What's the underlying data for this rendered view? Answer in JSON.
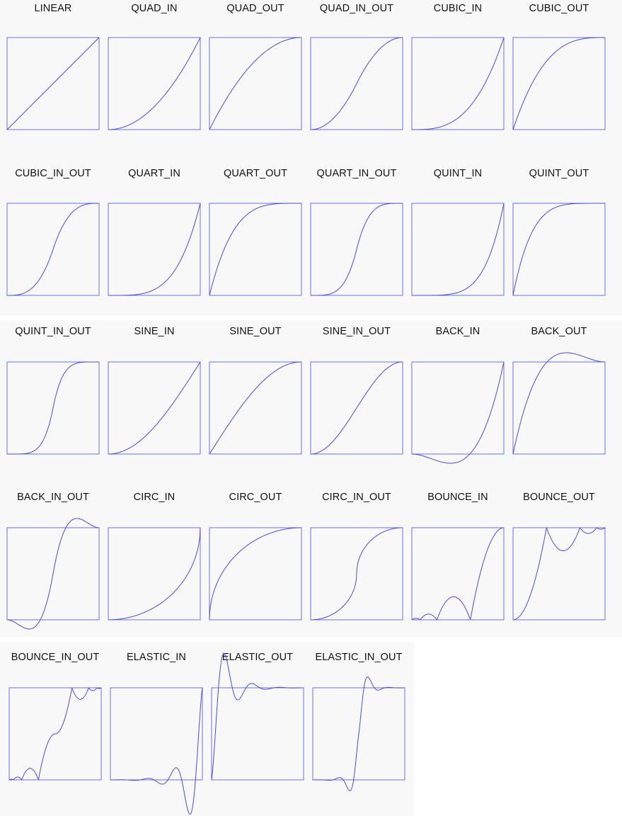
{
  "curve_color": "#4a4ae8",
  "box_color": "#6b6bf0",
  "panels": [
    {
      "name": "panel-1",
      "cells": [
        {
          "label": "LINEAR",
          "fn": "LINEAR"
        },
        {
          "label": "QUAD_IN",
          "fn": "QUAD_IN"
        },
        {
          "label": "QUAD_OUT",
          "fn": "QUAD_OUT"
        },
        {
          "label": "QUAD_IN_OUT",
          "fn": "QUAD_IN_OUT"
        },
        {
          "label": "CUBIC_IN",
          "fn": "CUBIC_IN"
        },
        {
          "label": "CUBIC_OUT",
          "fn": "CUBIC_OUT"
        },
        {
          "label": "CUBIC_IN_OUT",
          "fn": "CUBIC_IN_OUT"
        },
        {
          "label": "QUART_IN",
          "fn": "QUART_IN"
        },
        {
          "label": "QUART_OUT",
          "fn": "QUART_OUT"
        },
        {
          "label": "QUART_IN_OUT",
          "fn": "QUART_IN_OUT"
        },
        {
          "label": "QUINT_IN",
          "fn": "QUINT_IN"
        },
        {
          "label": "QUINT_OUT",
          "fn": "QUINT_OUT"
        }
      ]
    },
    {
      "name": "panel-2",
      "cells": [
        {
          "label": "QUINT_IN_OUT",
          "fn": "QUINT_IN_OUT"
        },
        {
          "label": "SINE_IN",
          "fn": "SINE_IN"
        },
        {
          "label": "SINE_OUT",
          "fn": "SINE_OUT"
        },
        {
          "label": "SINE_IN_OUT",
          "fn": "SINE_IN_OUT"
        },
        {
          "label": "BACK_IN",
          "fn": "BACK_IN"
        },
        {
          "label": "BACK_OUT",
          "fn": "BACK_OUT"
        },
        {
          "label": "BACK_IN_OUT",
          "fn": "BACK_IN_OUT"
        },
        {
          "label": "CIRC_IN",
          "fn": "CIRC_IN"
        },
        {
          "label": "CIRC_OUT",
          "fn": "CIRC_OUT"
        },
        {
          "label": "CIRC_IN_OUT",
          "fn": "CIRC_IN_OUT"
        },
        {
          "label": "BOUNCE_IN",
          "fn": "BOUNCE_IN"
        },
        {
          "label": "BOUNCE_OUT",
          "fn": "BOUNCE_OUT"
        }
      ]
    },
    {
      "name": "panel-3",
      "cells": [
        {
          "label": "BOUNCE_IN_OUT",
          "fn": "BOUNCE_IN_OUT"
        },
        {
          "label": "ELASTIC_IN",
          "fn": "ELASTIC_IN"
        },
        {
          "label": "ELASTIC_OUT",
          "fn": "ELASTIC_OUT"
        },
        {
          "label": "ELASTIC_IN_OUT",
          "fn": "ELASTIC_IN_OUT"
        }
      ]
    }
  ]
}
